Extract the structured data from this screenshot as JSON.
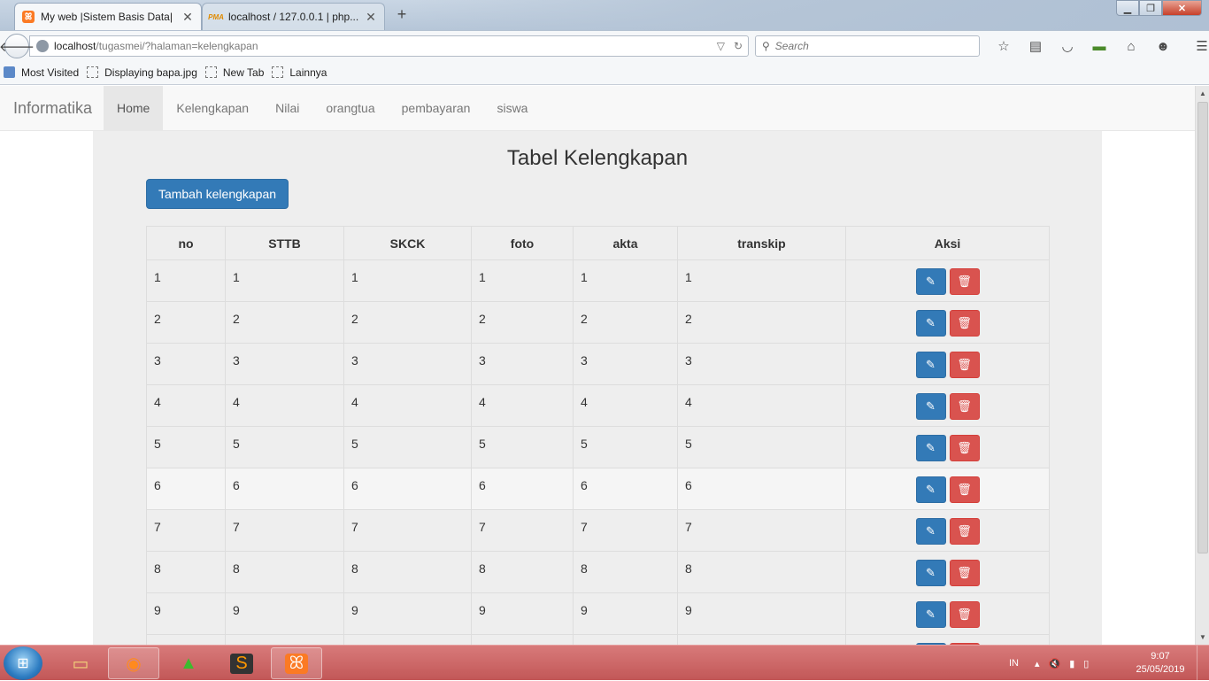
{
  "browser": {
    "tabs": [
      {
        "label": "My web |Sistem Basis Data|",
        "icon": "xampp-icon",
        "active": true
      },
      {
        "label": "localhost / 127.0.0.1 | php...",
        "icon": "phpmyadmin-icon",
        "active": false
      }
    ],
    "new_tab_glyph": "+",
    "url_host": "localhost",
    "url_path": "/tugasmei/?halaman=kelengkapan",
    "search_placeholder": "Search",
    "bookmarks": [
      {
        "label": "Most Visited",
        "icon": "folder-icon"
      },
      {
        "label": "Displaying bapa.jpg",
        "icon": "page-icon"
      },
      {
        "label": "New Tab",
        "icon": "page-icon"
      },
      {
        "label": "Lainnya",
        "icon": "page-icon"
      }
    ]
  },
  "app": {
    "brand": "Informatika",
    "nav": [
      "Home",
      "Kelengkapan",
      "Nilai",
      "orangtua",
      "pembayaran",
      "siswa"
    ],
    "active_nav": "Home",
    "title": "Tabel Kelengkapan",
    "add_button": "Tambah kelengkapan",
    "table": {
      "headers": [
        "no",
        "STTB",
        "SKCK",
        "foto",
        "akta",
        "transkip",
        "Aksi"
      ],
      "rows": [
        [
          "1",
          "1",
          "1",
          "1",
          "1",
          "1"
        ],
        [
          "2",
          "2",
          "2",
          "2",
          "2",
          "2"
        ],
        [
          "3",
          "3",
          "3",
          "3",
          "3",
          "3"
        ],
        [
          "4",
          "4",
          "4",
          "4",
          "4",
          "4"
        ],
        [
          "5",
          "5",
          "5",
          "5",
          "5",
          "5"
        ],
        [
          "6",
          "6",
          "6",
          "6",
          "6",
          "6"
        ],
        [
          "7",
          "7",
          "7",
          "7",
          "7",
          "7"
        ],
        [
          "8",
          "8",
          "8",
          "8",
          "8",
          "8"
        ],
        [
          "9",
          "9",
          "9",
          "9",
          "9",
          "9"
        ],
        [
          "",
          "",
          "",
          "",
          "",
          ""
        ]
      ],
      "hover_row": 5
    }
  },
  "taskbar": {
    "apps": [
      "explorer-icon",
      "firefox-icon",
      "utorrent-icon",
      "sublime-icon",
      "xampp-icon"
    ],
    "language": "IN",
    "time": "9:07",
    "date": "25/05/2019"
  },
  "colors": {
    "primary": "#337ab7",
    "danger": "#d9534f",
    "taskbar": "#c96363"
  }
}
